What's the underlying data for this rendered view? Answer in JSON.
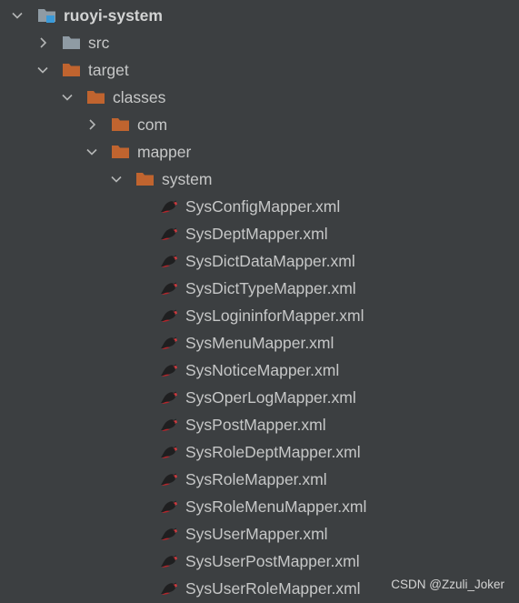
{
  "tree": {
    "nodes": [
      {
        "label": "ruoyi-system",
        "type": "module",
        "expanded": true
      },
      {
        "label": "src",
        "type": "folder-gray",
        "expanded": false
      },
      {
        "label": "target",
        "type": "folder-orange",
        "expanded": true
      },
      {
        "label": "classes",
        "type": "folder-orange",
        "expanded": true
      },
      {
        "label": "com",
        "type": "folder-orange",
        "expanded": false
      },
      {
        "label": "mapper",
        "type": "folder-orange",
        "expanded": true
      },
      {
        "label": "system",
        "type": "folder-orange",
        "expanded": true
      },
      {
        "label": "SysConfigMapper.xml",
        "type": "xml-file"
      },
      {
        "label": "SysDeptMapper.xml",
        "type": "xml-file"
      },
      {
        "label": "SysDictDataMapper.xml",
        "type": "xml-file"
      },
      {
        "label": "SysDictTypeMapper.xml",
        "type": "xml-file"
      },
      {
        "label": "SysLogininforMapper.xml",
        "type": "xml-file"
      },
      {
        "label": "SysMenuMapper.xml",
        "type": "xml-file"
      },
      {
        "label": "SysNoticeMapper.xml",
        "type": "xml-file"
      },
      {
        "label": "SysOperLogMapper.xml",
        "type": "xml-file"
      },
      {
        "label": "SysPostMapper.xml",
        "type": "xml-file"
      },
      {
        "label": "SysRoleDeptMapper.xml",
        "type": "xml-file"
      },
      {
        "label": "SysRoleMapper.xml",
        "type": "xml-file"
      },
      {
        "label": "SysRoleMenuMapper.xml",
        "type": "xml-file"
      },
      {
        "label": "SysUserMapper.xml",
        "type": "xml-file"
      },
      {
        "label": "SysUserPostMapper.xml",
        "type": "xml-file"
      },
      {
        "label": "SysUserRoleMapper.xml",
        "type": "xml-file"
      }
    ]
  },
  "icons": {
    "chevron_expanded": "chevron-down-icon",
    "chevron_collapsed": "chevron-right-icon",
    "module": "module-folder-icon",
    "folder_gray": "source-folder-icon",
    "folder_orange": "excluded-folder-icon",
    "xml": "mybatis-xml-icon"
  },
  "colors": {
    "background": "#3c3f41",
    "text": "#c6c7c7",
    "folder_orange": "#c0642f",
    "folder_gray": "#8f9ba4",
    "module_blue": "#3a9ad9",
    "xml_red": "#b3252b"
  },
  "watermark": {
    "text": "CSDN @Zzuli_Joker"
  }
}
